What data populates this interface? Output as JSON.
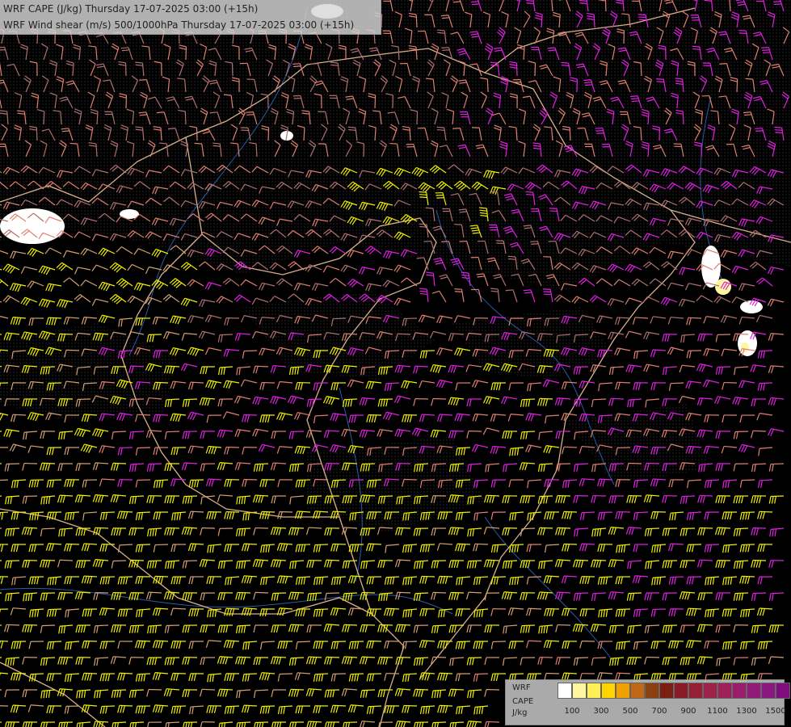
{
  "header": {
    "line1": "WRF CAPE (J/kg) Thursday 17-07-2025 03:00 (+15h)",
    "line2": "WRF Wind shear (m/s) 500/1000hPa Thursday 17-07-2025 03:00 (+15h)"
  },
  "legend": {
    "label_model": "WRF",
    "label_var": "CAPE",
    "label_unit": "J/kg",
    "colors": [
      "#ffffff",
      "#fff6a0",
      "#ffee55",
      "#ffd400",
      "#f0a000",
      "#c06818",
      "#8c4010",
      "#7a2010",
      "#8a1a28",
      "#952035",
      "#9c2248",
      "#a0205a",
      "#9a1c6a",
      "#921a78",
      "#8a1880",
      "#800c80"
    ],
    "ticks": [
      "100",
      "300",
      "500",
      "700",
      "900",
      "1100",
      "1300",
      "1500"
    ]
  },
  "colors": {
    "shear_strong": "#f0f000",
    "shear_moderate": "#e08070",
    "shear_tan": "#d4a070",
    "shear_magenta": "#e020e0",
    "shear_weak": "#b07070",
    "border": "#d9b08c",
    "river": "#2a5caa"
  },
  "icons": [
    "wind-barb-icon"
  ]
}
